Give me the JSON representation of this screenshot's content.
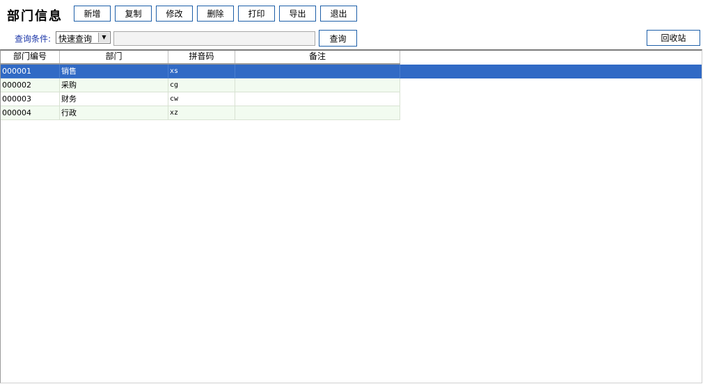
{
  "window": {
    "title": "部门信息"
  },
  "toolbar": {
    "buttons": [
      "新增",
      "复制",
      "修改",
      "删除",
      "打印",
      "导出",
      "退出"
    ]
  },
  "query": {
    "label": "查询条件:",
    "mode_value": "快速查询",
    "input_value": "",
    "search_label": "查询",
    "recycle_label": "回收站"
  },
  "table": {
    "columns": [
      "部门编号",
      "部门",
      "拼音码",
      "备注"
    ],
    "rows": [
      {
        "code": "000001",
        "name": "销售",
        "pinyin": "xs",
        "note": ""
      },
      {
        "code": "000002",
        "name": "采购",
        "pinyin": "cg",
        "note": ""
      },
      {
        "code": "000003",
        "name": "财务",
        "pinyin": "cw",
        "note": ""
      },
      {
        "code": "000004",
        "name": "行政",
        "pinyin": "xz",
        "note": ""
      }
    ],
    "selected_row": 0,
    "colors": {
      "selected": "#316ac5",
      "alt_row": "#f2fbf0",
      "button_border": "#1c5ea8",
      "label": "#1a35a8"
    }
  }
}
